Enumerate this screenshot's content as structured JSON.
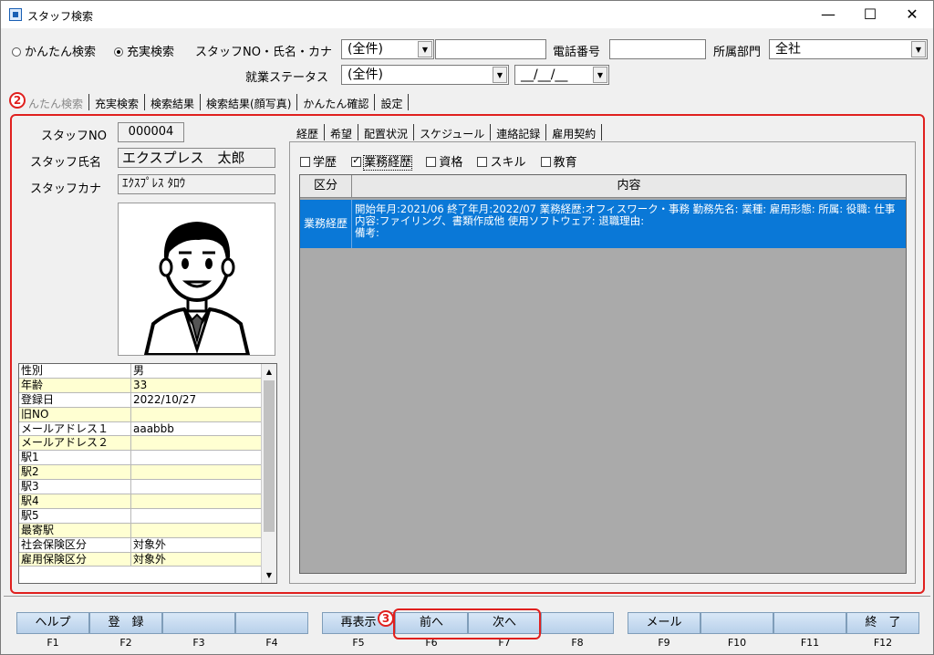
{
  "window": {
    "title": "スタッフ検索",
    "minimize": "—",
    "maximize": "☐",
    "close": "✕"
  },
  "search": {
    "radio_simple": "かんたん検索",
    "radio_full": "充実検索",
    "staff_label": "スタッフNO・氏名・カナ",
    "staff_combo": "(全件)",
    "phone_label": "電話番号",
    "dept_label": "所属部門",
    "dept_value": "全社",
    "status_label": "就業ステータス",
    "status_combo": "(全件)",
    "date_value": "__/__/__"
  },
  "main_tabs": [
    "かんたん検索",
    "充実検索",
    "検索結果",
    "検索結果(顔写真)",
    "かんたん確認",
    "設定"
  ],
  "main_tab_visible": [
    "んたん検索",
    "充実検索",
    "検索結果",
    "検索結果(顔写真)",
    "かんたん確認",
    "設定"
  ],
  "badges": {
    "b2": "2",
    "b3": "3"
  },
  "staff": {
    "no_label": "スタッフNO",
    "no_value": "000004",
    "name_label": "スタッフ氏名",
    "name_value": "エクスプレス　太郎",
    "kana_label": "スタッフカナ",
    "kana_value": "ｴｸｽﾌﾟﾚｽ ﾀﾛｳ"
  },
  "details": [
    {
      "k": "性別",
      "v": "男"
    },
    {
      "k": "年齢",
      "v": "33"
    },
    {
      "k": "登録日",
      "v": "2022/10/27"
    },
    {
      "k": "旧NO",
      "v": ""
    },
    {
      "k": "メールアドレス１",
      "v": "aaabbb"
    },
    {
      "k": "メールアドレス２",
      "v": ""
    },
    {
      "k": "駅1",
      "v": ""
    },
    {
      "k": "駅2",
      "v": ""
    },
    {
      "k": "駅3",
      "v": ""
    },
    {
      "k": "駅4",
      "v": ""
    },
    {
      "k": "駅5",
      "v": ""
    },
    {
      "k": "最寄駅",
      "v": ""
    },
    {
      "k": "社会保険区分",
      "v": "対象外"
    },
    {
      "k": "雇用保険区分",
      "v": "対象外"
    }
  ],
  "sub_tabs": [
    "経歴",
    "希望",
    "配置状況",
    "スケジュール",
    "連絡記録",
    "雇用契約"
  ],
  "filters": [
    {
      "label": "学歴",
      "checked": false
    },
    {
      "label": "業務経歴",
      "checked": true
    },
    {
      "label": "資格",
      "checked": false
    },
    {
      "label": "スキル",
      "checked": false
    },
    {
      "label": "教育",
      "checked": false
    }
  ],
  "history": {
    "col_kind": "区分",
    "col_content": "内容",
    "row_kind": "業務経歴",
    "row_content": "開始年月:2021/06 終了年月:2022/07 業務経歴:オフィスワーク・事務 勤務先名: 業種: 雇用形態: 所属: 役職: 仕事内容:ファイリング、書類作成他 使用ソフトウェア: 退職理由:\n備考:"
  },
  "fkeys": [
    {
      "label": "ヘルプ",
      "key": "F1"
    },
    {
      "label": "登　録",
      "key": "F2"
    },
    {
      "label": "",
      "key": "F3"
    },
    {
      "label": "",
      "key": "F4"
    },
    {
      "label": "再表示",
      "key": "F5"
    },
    {
      "label": "前へ",
      "key": "F6"
    },
    {
      "label": "次へ",
      "key": "F7"
    },
    {
      "label": "",
      "key": "F8"
    },
    {
      "label": "メール",
      "key": "F9"
    },
    {
      "label": "",
      "key": "F10"
    },
    {
      "label": "",
      "key": "F11"
    },
    {
      "label": "終　了",
      "key": "F12"
    }
  ]
}
